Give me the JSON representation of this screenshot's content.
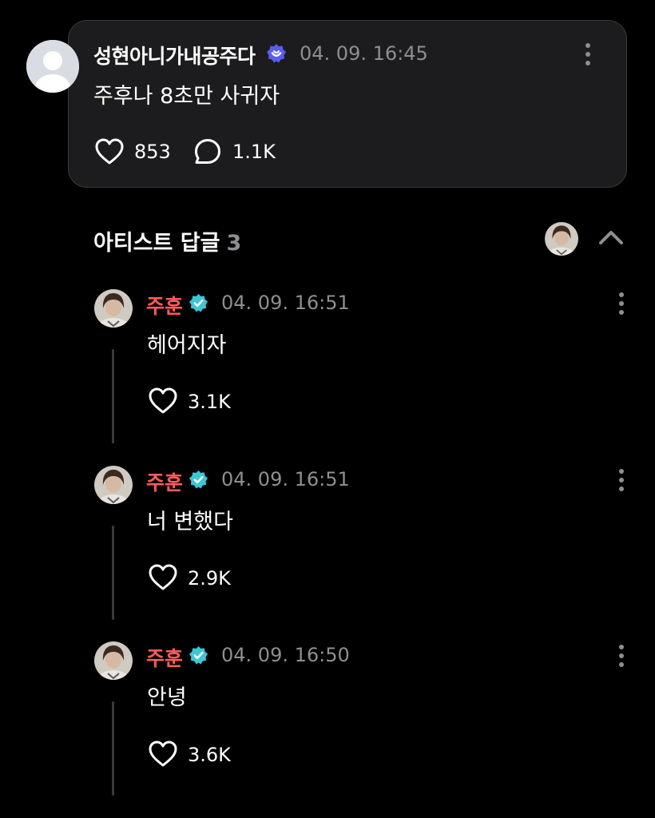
{
  "post": {
    "author": "성현아니가내공주다",
    "timestamp": "04. 09. 16:45",
    "body": "주후나 8초만 사귀자",
    "likes": "853",
    "comments": "1.1K",
    "badge_color": "#5b5cf0"
  },
  "artist_replies": {
    "title": "아티스트 답글",
    "count": "3",
    "replies": [
      {
        "author": "주훈",
        "timestamp": "04. 09. 16:51",
        "body": "헤어지자",
        "likes": "3.1K"
      },
      {
        "author": "주훈",
        "timestamp": "04. 09. 16:51",
        "body": "너 변했다",
        "likes": "2.9K"
      },
      {
        "author": "주훈",
        "timestamp": "04. 09. 16:50",
        "body": "안녕",
        "likes": "3.6K"
      }
    ]
  },
  "colors": {
    "background": "#000000",
    "card": "#1c1c1e",
    "artist_name": "#ff5a5a",
    "verified_badge": "#3dc6d6",
    "muted_text": "#8e8e93"
  },
  "icons": {
    "like": "heart-icon",
    "comment": "comment-bubble-icon",
    "more": "more-vertical-icon",
    "collapse": "chevron-up-icon",
    "verified": "verified-badge-icon"
  }
}
